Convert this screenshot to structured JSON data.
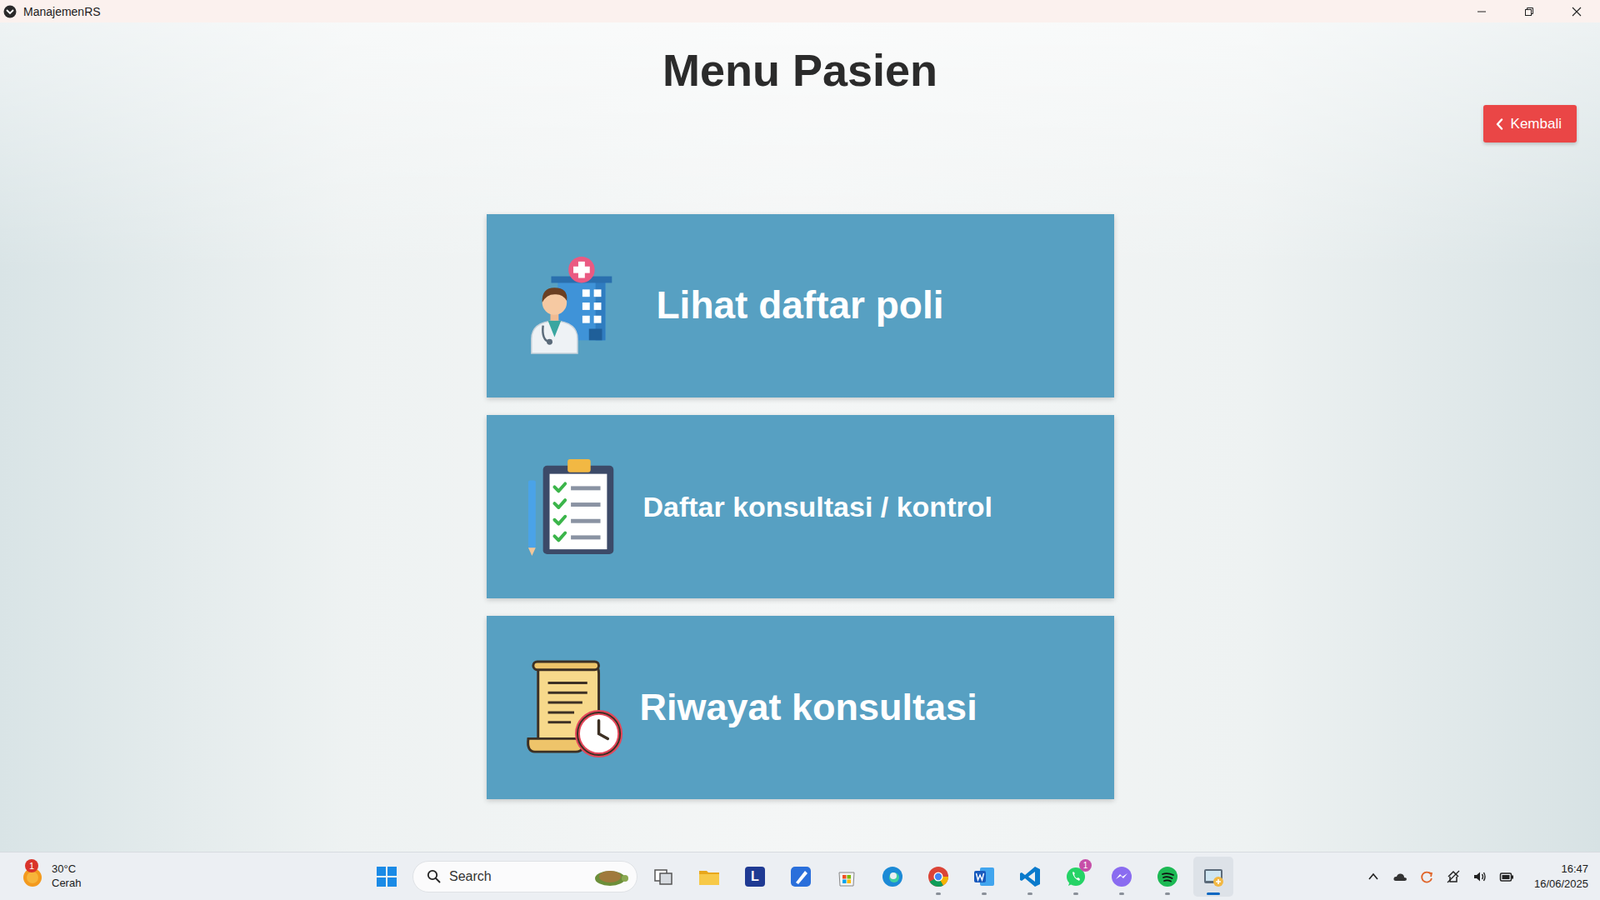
{
  "window": {
    "title": "ManajemenRS"
  },
  "heading": "Menu Pasien",
  "back_button": {
    "label": "Kembali"
  },
  "menu": [
    {
      "label": "Lihat daftar poli",
      "kind": "poli"
    },
    {
      "label": "Daftar konsultasi / kontrol",
      "kind": "checklist"
    },
    {
      "label": "Riwayat konsultasi",
      "kind": "history"
    }
  ],
  "taskbar": {
    "weather": {
      "temperature": "30°C",
      "condition": "Cerah",
      "badge": "1"
    },
    "search": {
      "placeholder": "Search"
    },
    "apps": [
      {
        "kind": "taskview",
        "running": false,
        "selected": false
      },
      {
        "kind": "explorer",
        "running": false,
        "selected": false
      },
      {
        "kind": "letter",
        "text": "L",
        "running": false,
        "selected": false
      },
      {
        "kind": "pen",
        "running": false,
        "selected": false
      },
      {
        "kind": "store",
        "running": false,
        "selected": false
      },
      {
        "kind": "edge",
        "running": false,
        "selected": false
      },
      {
        "kind": "chrome",
        "running": true,
        "selected": false
      },
      {
        "kind": "word",
        "running": true,
        "selected": false
      },
      {
        "kind": "vscode",
        "running": true,
        "selected": false
      },
      {
        "kind": "whatsapp",
        "badge": "1",
        "running": true,
        "selected": false
      },
      {
        "kind": "messenger",
        "running": true,
        "selected": false
      },
      {
        "kind": "spotify",
        "running": true,
        "selected": false
      },
      {
        "kind": "manajemen",
        "running": true,
        "selected": true
      }
    ],
    "clock": {
      "time": "16:47",
      "date": "16/06/2025"
    }
  }
}
